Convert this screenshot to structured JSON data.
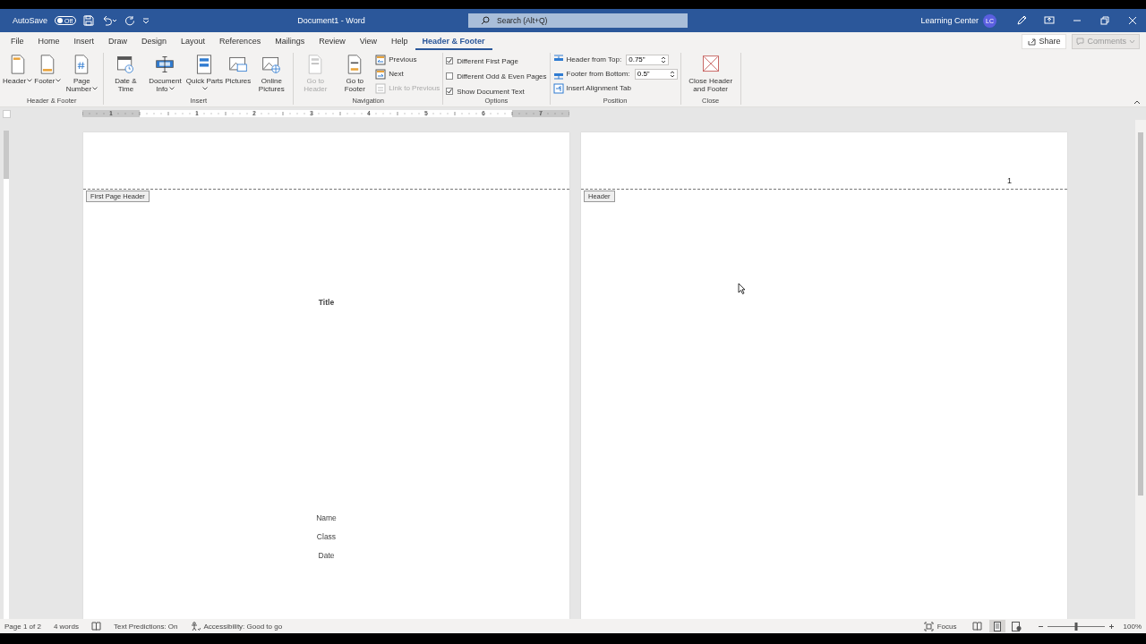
{
  "titlebar": {
    "autosave": "AutoSave",
    "toggle": {
      "label": "Off",
      "on": false
    },
    "title": "Document1  -  Word",
    "search": {
      "placeholder": "Search (Alt+Q)"
    },
    "user": "Learning Center",
    "avatar": "LC"
  },
  "tabs": [
    {
      "label": "File",
      "selected": false
    },
    {
      "label": "Home",
      "selected": false
    },
    {
      "label": "Insert",
      "selected": false
    },
    {
      "label": "Draw",
      "selected": false
    },
    {
      "label": "Design",
      "selected": false
    },
    {
      "label": "Layout",
      "selected": false
    },
    {
      "label": "References",
      "selected": false
    },
    {
      "label": "Mailings",
      "selected": false
    },
    {
      "label": "Review",
      "selected": false
    },
    {
      "label": "View",
      "selected": false
    },
    {
      "label": "Help",
      "selected": false
    },
    {
      "label": "Header & Footer",
      "selected": true
    }
  ],
  "share": "Share",
  "comments": {
    "label": "Comments",
    "disabled": true
  },
  "ribbon": [
    {
      "name": "Header & Footer",
      "items": [
        {
          "kind": "large",
          "label": "Header",
          "dropdown": true,
          "disabled": false
        },
        {
          "kind": "large",
          "label": "Footer",
          "dropdown": true,
          "disabled": false
        },
        {
          "kind": "large",
          "label": "Page Number",
          "dropdown": true,
          "disabled": false
        }
      ]
    },
    {
      "name": "Insert",
      "items": [
        {
          "kind": "large",
          "label": "Date & Time",
          "dropdown": false,
          "disabled": false
        },
        {
          "kind": "large",
          "label": "Document Info",
          "dropdown": true,
          "disabled": false
        },
        {
          "kind": "large",
          "label": "Quick Parts",
          "dropdown": true,
          "disabled": false
        },
        {
          "kind": "large",
          "label": "Pictures",
          "dropdown": false,
          "disabled": false
        },
        {
          "kind": "large",
          "label": "Online Pictures",
          "dropdown": false,
          "disabled": false
        }
      ]
    },
    {
      "name": "Navigation",
      "items": [
        {
          "kind": "large",
          "label": "Go to Header",
          "dropdown": false,
          "disabled": true
        },
        {
          "kind": "large",
          "label": "Go to Footer",
          "dropdown": false,
          "disabled": false
        },
        {
          "kind": "small",
          "label": "Previous",
          "disabled": false
        },
        {
          "kind": "small",
          "label": "Next",
          "disabled": false
        },
        {
          "kind": "small",
          "label": "Link to Previous",
          "disabled": true
        }
      ]
    },
    {
      "name": "Options",
      "items": [
        {
          "kind": "check",
          "label": "Different First Page",
          "checked": true
        },
        {
          "kind": "check",
          "label": "Different Odd & Even Pages",
          "checked": false
        },
        {
          "kind": "check",
          "label": "Show Document Text",
          "checked": true
        }
      ]
    },
    {
      "name": "Position",
      "items": [
        {
          "kind": "spin",
          "label": "Header from Top:",
          "value": "0.75\""
        },
        {
          "kind": "spin",
          "label": "Footer from Bottom:",
          "value": "0.5\""
        },
        {
          "kind": "small",
          "label": "Insert Alignment Tab",
          "disabled": false
        }
      ]
    },
    {
      "name": "Close",
      "items": [
        {
          "kind": "large",
          "label": "Close Header and Footer",
          "dropdown": false,
          "disabled": false
        }
      ]
    }
  ],
  "ruler": [
    "1",
    "1",
    "2",
    "3",
    "4",
    "5",
    "6",
    "7"
  ],
  "pages": [
    {
      "header_tag": "First Page Header",
      "lines": [
        {
          "kind": "title",
          "text": "Title"
        },
        {
          "kind": "info",
          "text": "Name"
        },
        {
          "kind": "info",
          "text": "Class"
        },
        {
          "kind": "info",
          "text": "Date"
        }
      ]
    },
    {
      "header_tag": "Header",
      "header_text": "1"
    }
  ],
  "status": {
    "page": "Page 1 of 2",
    "words": "4 words",
    "predictions": "Text Predictions: On",
    "accessibility": "Accessibility: Good to go",
    "focus": "Focus",
    "views": [
      {
        "kind": "read",
        "selected": false
      },
      {
        "kind": "print",
        "selected": true
      },
      {
        "kind": "web",
        "selected": false
      }
    ],
    "zoom": {
      "level": 0.5,
      "reading": "100%"
    }
  }
}
